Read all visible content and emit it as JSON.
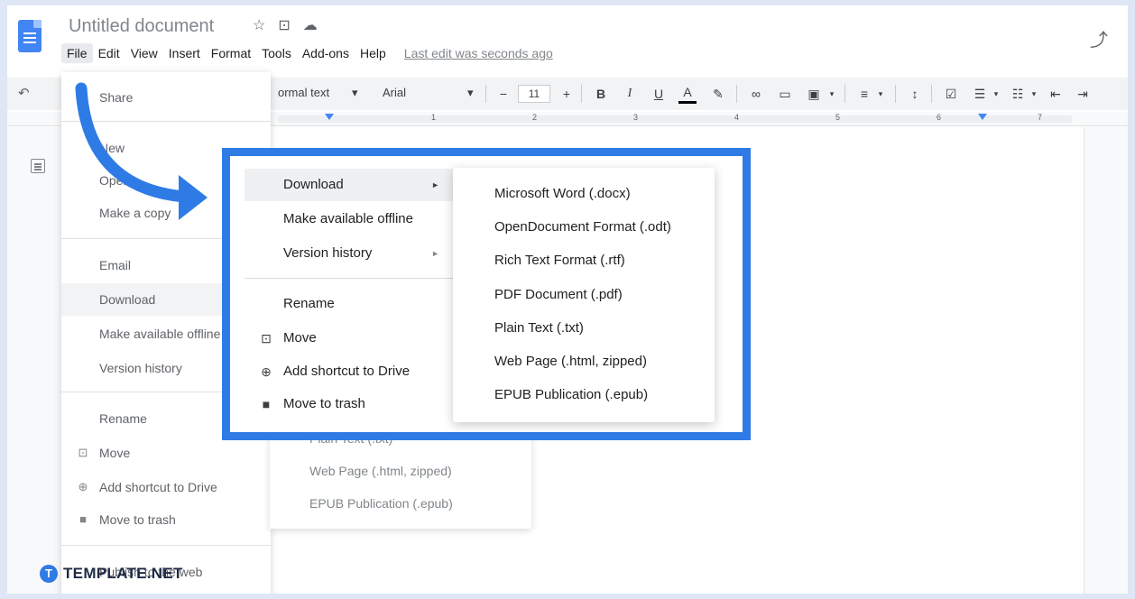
{
  "header": {
    "title": "Untitled document",
    "last_edit": "Last edit was seconds ago",
    "menus": [
      "File",
      "Edit",
      "View",
      "Insert",
      "Format",
      "Tools",
      "Add-ons",
      "Help"
    ]
  },
  "toolbar": {
    "style": "ormal text",
    "font": "Arial",
    "font_size": "11",
    "minus": "−",
    "plus": "+",
    "bold": "B",
    "italic": "I",
    "underline": "U",
    "text_color": "A"
  },
  "ruler": [
    "1",
    "2",
    "3",
    "4",
    "5",
    "6",
    "7"
  ],
  "file_menu": {
    "share": "Share",
    "new": "New",
    "open": "Open",
    "make_copy": "Make a copy",
    "email": "Email",
    "download": "Download",
    "offline": "Make available offline",
    "version_history": "Version history",
    "rename": "Rename",
    "move": "Move",
    "add_shortcut": "Add shortcut to Drive",
    "trash": "Move to trash",
    "publish": "Publish to the web"
  },
  "faded_submenu": [
    "Plain Text (.txt)",
    "Web Page (.html, zipped)",
    "EPUB Publication (.epub)"
  ],
  "zoom_menu": {
    "download": "Download",
    "offline": "Make available offline",
    "version_history": "Version history",
    "rename": "Rename",
    "move": "Move",
    "add_shortcut": "Add shortcut to Drive",
    "trash": "Move to trash"
  },
  "download_submenu": [
    "Microsoft Word (.docx)",
    "OpenDocument Format (.odt)",
    "Rich Text Format (.rtf)",
    "PDF Document (.pdf)",
    "Plain Text (.txt)",
    "Web Page (.html, zipped)",
    "EPUB Publication (.epub)"
  ],
  "watermark": {
    "logo": "T",
    "text": "TEMPLATE.NET"
  },
  "colors": {
    "accent": "#2f7be5",
    "doc_blue": "#4285f4"
  }
}
